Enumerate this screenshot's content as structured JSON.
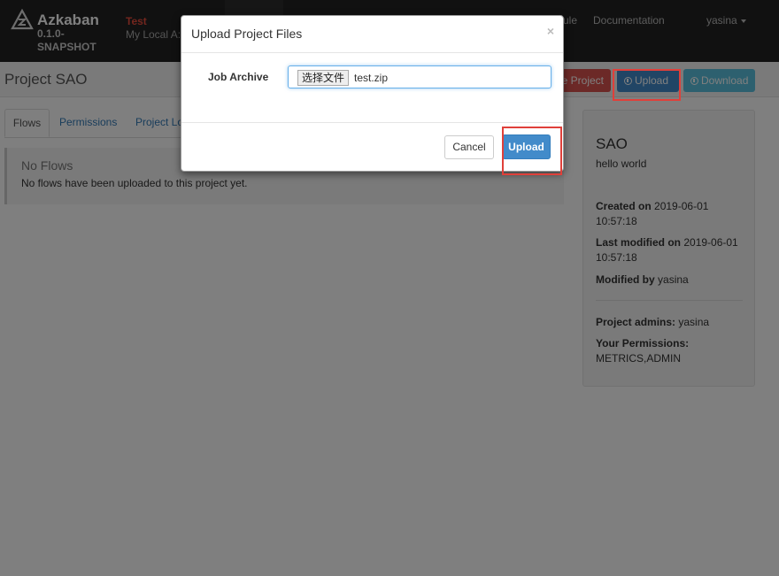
{
  "navbar": {
    "brand_name": "Azkaban",
    "brand_version": "0.1.0-SNAPSHOT",
    "env_name": "Test",
    "env_desc": "My Local A:",
    "links": [
      "ule",
      "Documentation"
    ],
    "user": "yasina"
  },
  "page_header": {
    "title": "Project SAO",
    "delete_label": "e Project",
    "upload_label": "Upload",
    "download_label": "Download"
  },
  "tabs": [
    "Flows",
    "Permissions",
    "Project Lo"
  ],
  "flows": {
    "heading": "No Flows",
    "text": "No flows have been uploaded to this project yet."
  },
  "sidebar": {
    "name": "SAO",
    "description": "hello world",
    "created_label": "Created on",
    "created_value": "2019-06-01 10:57:18",
    "modified_label": "Last modified on",
    "modified_value": "2019-06-01 10:57:18",
    "modified_by_label": "Modified by",
    "modified_by_value": "yasina",
    "admins_label": "Project admins:",
    "admins_value": "yasina",
    "permissions_label": "Your Permissions:",
    "permissions_value": "METRICS,ADMIN"
  },
  "modal": {
    "title": "Upload Project Files",
    "close_symbol": "×",
    "field_label": "Job Archive",
    "file_button_label": "选择文件",
    "file_name": "test.zip",
    "cancel_label": "Cancel",
    "upload_label": "Upload"
  },
  "colors": {
    "navbar_bg": "#222222",
    "env_name": "#e74c3c",
    "btn_primary": "#428bca",
    "btn_danger": "#d9534f",
    "btn_info": "#5bc0de",
    "highlight": "#e0403a"
  },
  "icons": [
    "azkaban-logo-icon",
    "caret-down-icon",
    "upload-circle-icon",
    "download-circle-icon",
    "close-icon"
  ]
}
